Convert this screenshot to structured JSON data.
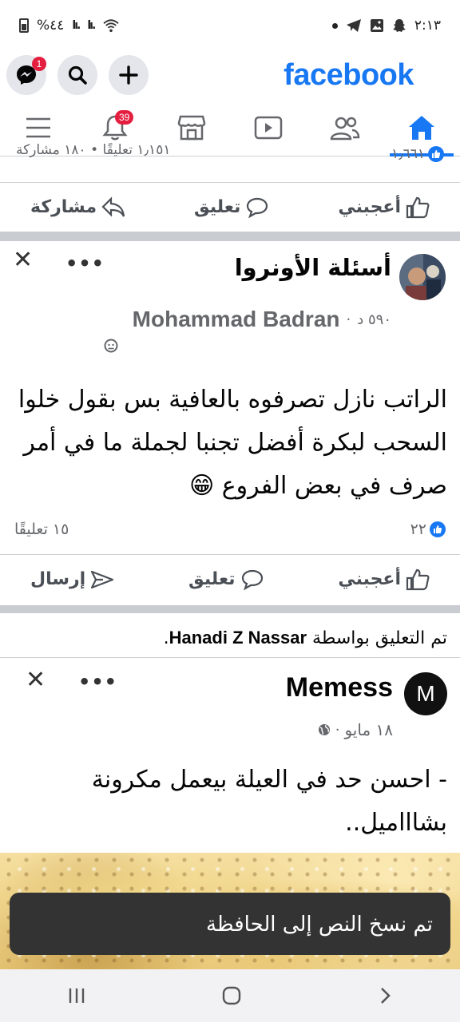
{
  "status_bar": {
    "time": "٢:١٣",
    "battery": "%٤٤",
    "signal_1": "lı.",
    "signal_2": "lı."
  },
  "header": {
    "logo": "facebook",
    "messenger_badge": "1",
    "notifications_badge": "39"
  },
  "previous_post": {
    "reactions": "١٫٦٦١",
    "stats": "١٫١٥١ تعليقًا • ١٨٠ مشاركة",
    "actions": {
      "like": "أعجبني",
      "comment": "تعليق",
      "share": "مشاركة"
    }
  },
  "post1": {
    "group": "أسئلة الأونروا",
    "time": "٥٩٠ د",
    "author": "Mohammad Badran",
    "text": "الراتب نازل تصرفوه بالعافية بس بقول خلوا السحب لبكرة أفضل تجنبا لجملة ما في أمر صرف في بعض الفروع 😁",
    "reactions": "٢٢",
    "comments": "١٥ تعليقًا",
    "actions": {
      "like": "أعجبني",
      "comment": "تعليق",
      "send": "إرسال"
    }
  },
  "commented_by": {
    "prefix": "تم التعليق بواسطة",
    "name": "Hanadi Z Nassar",
    "suffix": "."
  },
  "post2": {
    "page": "Memess",
    "avatar_letter": "M",
    "time": "١٨ مايو",
    "text": "- احسن حد في العيلة بيعمل مكرونة بشاااميل.."
  },
  "toast": "تم نسخ النص إلى الحافظة",
  "colors": {
    "brand": "#1877f2",
    "badge": "#e41e3f",
    "toast_bg": "#333333"
  }
}
